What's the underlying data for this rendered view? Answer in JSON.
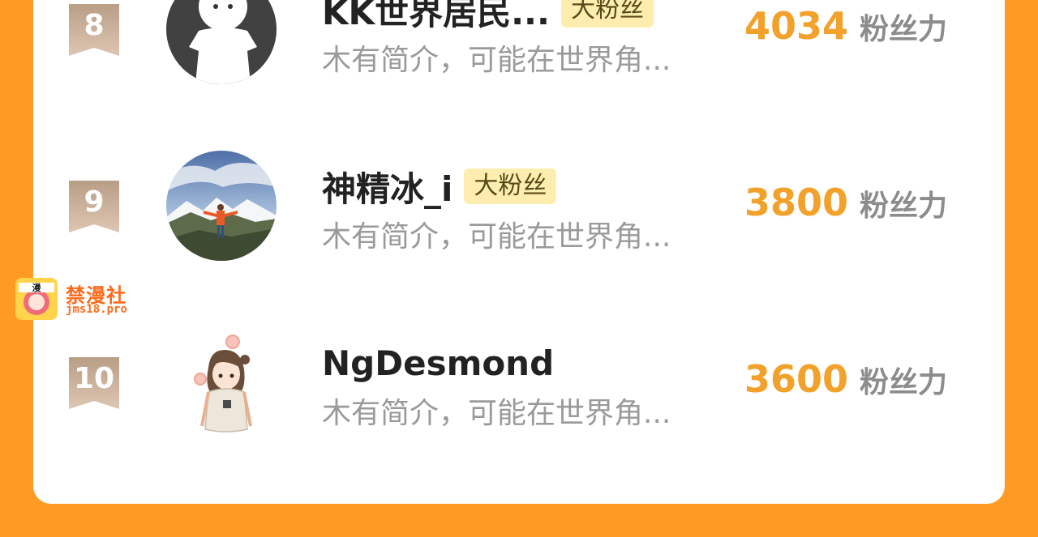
{
  "rows": [
    {
      "rank": "8",
      "name": "KK世界居民...",
      "tag": "大粉丝",
      "bio": "木有简介，可能在世界角...",
      "score": "4034",
      "unit": "粉丝力",
      "avatar": "default-ghost-avatar"
    },
    {
      "rank": "9",
      "name": "神精冰_i",
      "tag": "大粉丝",
      "bio": "木有简介，可能在世界角...",
      "score": "3800",
      "unit": "粉丝力",
      "avatar": "mountain-photo-avatar"
    },
    {
      "rank": "10",
      "name": "NgDesmond",
      "tag": "",
      "bio": "木有简介，可能在世界角...",
      "score": "3600",
      "unit": "粉丝力",
      "avatar": "anime-girl-avatar"
    }
  ],
  "watermark": {
    "title": "禁漫社",
    "url": "jms18.pro"
  },
  "colors": {
    "background": "#ff9b24",
    "score": "#f2a12a",
    "tag_bg": "#fdeeb0",
    "badge": "#c9ad95"
  }
}
